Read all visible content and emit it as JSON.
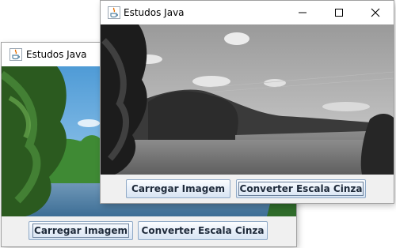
{
  "back_window": {
    "title": "Estudos Java",
    "title_icon": "java-coffee-icon",
    "image": "color-lake-photo",
    "buttons": {
      "load": "Carregar Imagem",
      "convert": "Converter Escala Cinza"
    }
  },
  "front_window": {
    "title": "Estudos Java",
    "title_icon": "java-coffee-icon",
    "image": "grayscale-lake-photo",
    "controls": [
      "minimize-icon",
      "maximize-icon",
      "close-icon"
    ],
    "buttons": {
      "load": "Carregar Imagem",
      "convert": "Converter Escala Cinza"
    }
  },
  "colors": {
    "window_bg": "#f0f0f0",
    "titlebar": "#ffffff",
    "button_border": "#8fa9c6",
    "button_text": "#1e2a3a"
  }
}
